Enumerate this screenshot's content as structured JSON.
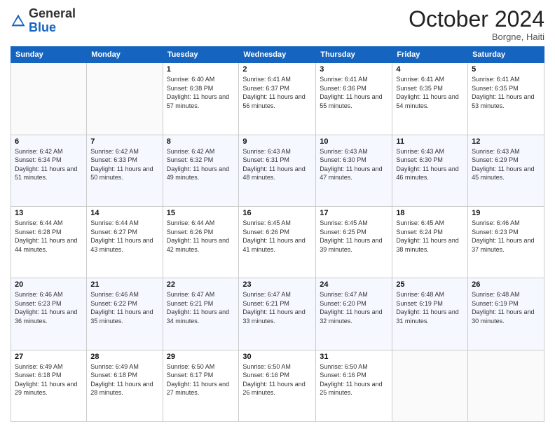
{
  "logo": {
    "general": "General",
    "blue": "Blue"
  },
  "header": {
    "month": "October 2024",
    "location": "Borgne, Haiti"
  },
  "days_of_week": [
    "Sunday",
    "Monday",
    "Tuesday",
    "Wednesday",
    "Thursday",
    "Friday",
    "Saturday"
  ],
  "weeks": [
    [
      {
        "day": "",
        "sunrise": "",
        "sunset": "",
        "daylight": ""
      },
      {
        "day": "",
        "sunrise": "",
        "sunset": "",
        "daylight": ""
      },
      {
        "day": "1",
        "sunrise": "Sunrise: 6:40 AM",
        "sunset": "Sunset: 6:38 PM",
        "daylight": "Daylight: 11 hours and 57 minutes."
      },
      {
        "day": "2",
        "sunrise": "Sunrise: 6:41 AM",
        "sunset": "Sunset: 6:37 PM",
        "daylight": "Daylight: 11 hours and 56 minutes."
      },
      {
        "day": "3",
        "sunrise": "Sunrise: 6:41 AM",
        "sunset": "Sunset: 6:36 PM",
        "daylight": "Daylight: 11 hours and 55 minutes."
      },
      {
        "day": "4",
        "sunrise": "Sunrise: 6:41 AM",
        "sunset": "Sunset: 6:35 PM",
        "daylight": "Daylight: 11 hours and 54 minutes."
      },
      {
        "day": "5",
        "sunrise": "Sunrise: 6:41 AM",
        "sunset": "Sunset: 6:35 PM",
        "daylight": "Daylight: 11 hours and 53 minutes."
      }
    ],
    [
      {
        "day": "6",
        "sunrise": "Sunrise: 6:42 AM",
        "sunset": "Sunset: 6:34 PM",
        "daylight": "Daylight: 11 hours and 51 minutes."
      },
      {
        "day": "7",
        "sunrise": "Sunrise: 6:42 AM",
        "sunset": "Sunset: 6:33 PM",
        "daylight": "Daylight: 11 hours and 50 minutes."
      },
      {
        "day": "8",
        "sunrise": "Sunrise: 6:42 AM",
        "sunset": "Sunset: 6:32 PM",
        "daylight": "Daylight: 11 hours and 49 minutes."
      },
      {
        "day": "9",
        "sunrise": "Sunrise: 6:43 AM",
        "sunset": "Sunset: 6:31 PM",
        "daylight": "Daylight: 11 hours and 48 minutes."
      },
      {
        "day": "10",
        "sunrise": "Sunrise: 6:43 AM",
        "sunset": "Sunset: 6:30 PM",
        "daylight": "Daylight: 11 hours and 47 minutes."
      },
      {
        "day": "11",
        "sunrise": "Sunrise: 6:43 AM",
        "sunset": "Sunset: 6:30 PM",
        "daylight": "Daylight: 11 hours and 46 minutes."
      },
      {
        "day": "12",
        "sunrise": "Sunrise: 6:43 AM",
        "sunset": "Sunset: 6:29 PM",
        "daylight": "Daylight: 11 hours and 45 minutes."
      }
    ],
    [
      {
        "day": "13",
        "sunrise": "Sunrise: 6:44 AM",
        "sunset": "Sunset: 6:28 PM",
        "daylight": "Daylight: 11 hours and 44 minutes."
      },
      {
        "day": "14",
        "sunrise": "Sunrise: 6:44 AM",
        "sunset": "Sunset: 6:27 PM",
        "daylight": "Daylight: 11 hours and 43 minutes."
      },
      {
        "day": "15",
        "sunrise": "Sunrise: 6:44 AM",
        "sunset": "Sunset: 6:26 PM",
        "daylight": "Daylight: 11 hours and 42 minutes."
      },
      {
        "day": "16",
        "sunrise": "Sunrise: 6:45 AM",
        "sunset": "Sunset: 6:26 PM",
        "daylight": "Daylight: 11 hours and 41 minutes."
      },
      {
        "day": "17",
        "sunrise": "Sunrise: 6:45 AM",
        "sunset": "Sunset: 6:25 PM",
        "daylight": "Daylight: 11 hours and 39 minutes."
      },
      {
        "day": "18",
        "sunrise": "Sunrise: 6:45 AM",
        "sunset": "Sunset: 6:24 PM",
        "daylight": "Daylight: 11 hours and 38 minutes."
      },
      {
        "day": "19",
        "sunrise": "Sunrise: 6:46 AM",
        "sunset": "Sunset: 6:23 PM",
        "daylight": "Daylight: 11 hours and 37 minutes."
      }
    ],
    [
      {
        "day": "20",
        "sunrise": "Sunrise: 6:46 AM",
        "sunset": "Sunset: 6:23 PM",
        "daylight": "Daylight: 11 hours and 36 minutes."
      },
      {
        "day": "21",
        "sunrise": "Sunrise: 6:46 AM",
        "sunset": "Sunset: 6:22 PM",
        "daylight": "Daylight: 11 hours and 35 minutes."
      },
      {
        "day": "22",
        "sunrise": "Sunrise: 6:47 AM",
        "sunset": "Sunset: 6:21 PM",
        "daylight": "Daylight: 11 hours and 34 minutes."
      },
      {
        "day": "23",
        "sunrise": "Sunrise: 6:47 AM",
        "sunset": "Sunset: 6:21 PM",
        "daylight": "Daylight: 11 hours and 33 minutes."
      },
      {
        "day": "24",
        "sunrise": "Sunrise: 6:47 AM",
        "sunset": "Sunset: 6:20 PM",
        "daylight": "Daylight: 11 hours and 32 minutes."
      },
      {
        "day": "25",
        "sunrise": "Sunrise: 6:48 AM",
        "sunset": "Sunset: 6:19 PM",
        "daylight": "Daylight: 11 hours and 31 minutes."
      },
      {
        "day": "26",
        "sunrise": "Sunrise: 6:48 AM",
        "sunset": "Sunset: 6:19 PM",
        "daylight": "Daylight: 11 hours and 30 minutes."
      }
    ],
    [
      {
        "day": "27",
        "sunrise": "Sunrise: 6:49 AM",
        "sunset": "Sunset: 6:18 PM",
        "daylight": "Daylight: 11 hours and 29 minutes."
      },
      {
        "day": "28",
        "sunrise": "Sunrise: 6:49 AM",
        "sunset": "Sunset: 6:18 PM",
        "daylight": "Daylight: 11 hours and 28 minutes."
      },
      {
        "day": "29",
        "sunrise": "Sunrise: 6:50 AM",
        "sunset": "Sunset: 6:17 PM",
        "daylight": "Daylight: 11 hours and 27 minutes."
      },
      {
        "day": "30",
        "sunrise": "Sunrise: 6:50 AM",
        "sunset": "Sunset: 6:16 PM",
        "daylight": "Daylight: 11 hours and 26 minutes."
      },
      {
        "day": "31",
        "sunrise": "Sunrise: 6:50 AM",
        "sunset": "Sunset: 6:16 PM",
        "daylight": "Daylight: 11 hours and 25 minutes."
      },
      {
        "day": "",
        "sunrise": "",
        "sunset": "",
        "daylight": ""
      },
      {
        "day": "",
        "sunrise": "",
        "sunset": "",
        "daylight": ""
      }
    ]
  ]
}
